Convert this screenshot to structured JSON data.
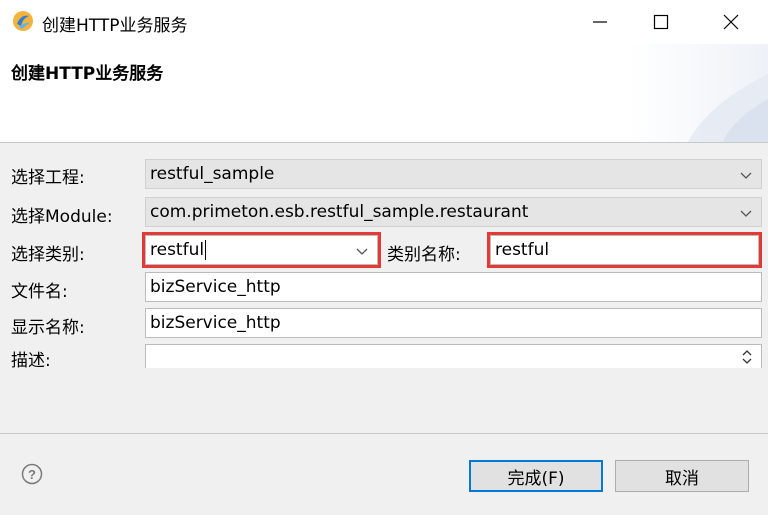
{
  "window": {
    "title": "创建HTTP业务服务",
    "controls": {
      "minimize_icon": "minimize-icon",
      "maximize_icon": "maximize-icon",
      "close_icon": "close-icon"
    }
  },
  "header": {
    "title": "创建HTTP业务服务"
  },
  "form": {
    "project": {
      "label": "选择工程:",
      "value": "restful_sample"
    },
    "module": {
      "label": "选择Module:",
      "value": "com.primeton.esb.restful_sample.restaurant"
    },
    "category": {
      "label": "选择类别:",
      "value": "restful"
    },
    "category_name": {
      "label": "类别名称:",
      "value": "restful"
    },
    "file_name": {
      "label": "文件名:",
      "value": "bizService_http"
    },
    "display_name": {
      "label": "显示名称:",
      "value": "bizService_http"
    },
    "description": {
      "label": "描述:",
      "value": ""
    }
  },
  "buttons": {
    "finish": "完成(F)",
    "cancel": "取消"
  },
  "colors": {
    "highlight": "#e53935",
    "default_button_border": "#0078d7"
  }
}
